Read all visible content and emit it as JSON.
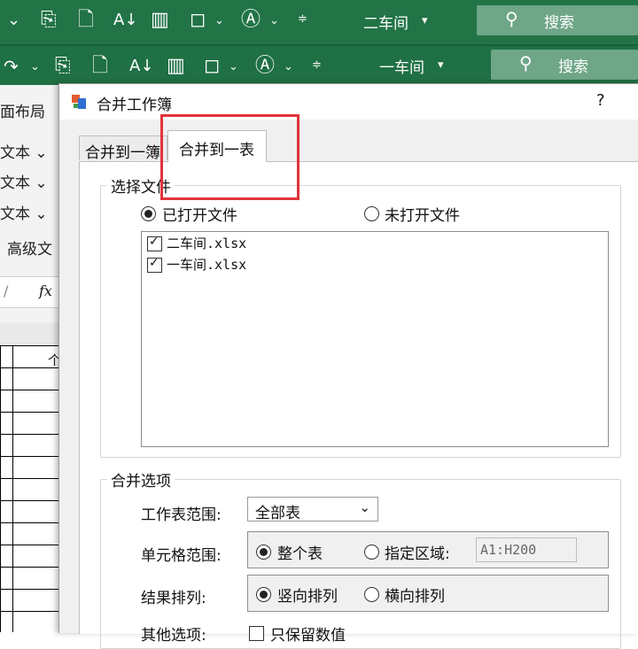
{
  "ribbon": {
    "window_title_back": "二车间",
    "window_title_front": "一车间",
    "search_label": "搜索"
  },
  "background": {
    "tab_partial": "面布局",
    "text_items": [
      "文本 ⌄",
      "文本 ⌄",
      "文本 ⌄"
    ],
    "advanced_partial": "高级文",
    "fx_label": "fx",
    "cell_partial": "个"
  },
  "dialog": {
    "title": "合并工作簿",
    "help": "?",
    "tabs": [
      {
        "label": "合并到一簿",
        "active": false
      },
      {
        "label": "合并到一表",
        "active": true
      }
    ],
    "select_files": {
      "title": "选择文件",
      "opened_label": "已打开文件",
      "unopened_label": "未打开文件",
      "selected": "opened",
      "files": [
        {
          "name": "二车间.xlsx",
          "checked": true
        },
        {
          "name": "一车间.xlsx",
          "checked": true
        }
      ]
    },
    "merge_options": {
      "title": "合并选项",
      "sheet_range_label": "工作表范围:",
      "sheet_range_value": "全部表",
      "cell_range_label": "单元格范围:",
      "whole_sheet_label": "整个表",
      "specified_label": "指定区域:",
      "specified_value": "A1:H200",
      "cell_range_selected": "whole",
      "result_order_label": "结果排列:",
      "vertical_label": "竖向排列",
      "horizontal_label": "横向排列",
      "order_selected": "vertical",
      "other_label": "其他选项:",
      "other_option_partial": "只保留数值"
    }
  },
  "colors": {
    "ribbon_green": "#227447",
    "highlight_red": "#e0343a"
  }
}
